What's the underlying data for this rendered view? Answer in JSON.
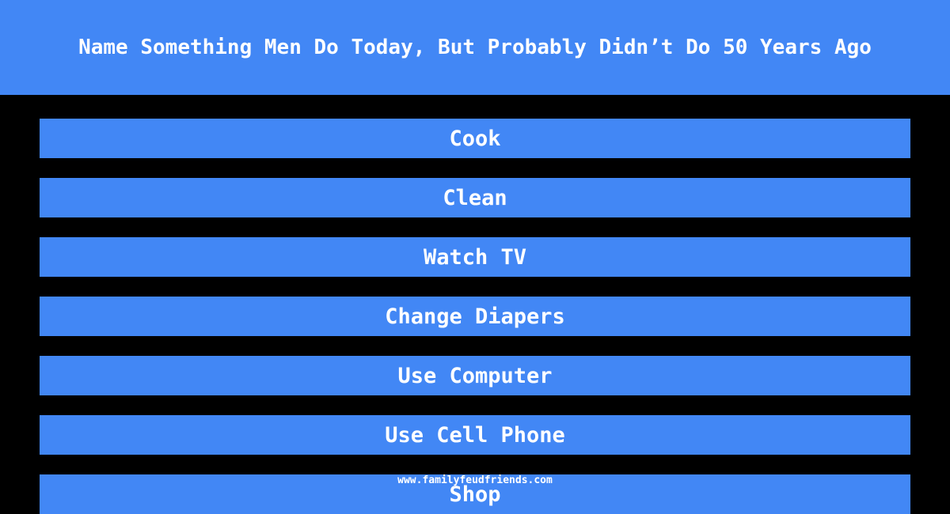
{
  "question": "Name Something Men Do Today, But Probably Didn’t Do 50 Years Ago",
  "answers": [
    {
      "label": "Cook"
    },
    {
      "label": "Clean"
    },
    {
      "label": "Watch TV"
    },
    {
      "label": "Change Diapers"
    },
    {
      "label": "Use Computer"
    },
    {
      "label": "Use Cell Phone"
    },
    {
      "label": "Shop"
    }
  ],
  "watermark": "www.familyfeudfriends.com",
  "colors": {
    "accent": "#4287f5",
    "background": "#000000",
    "text": "#ffffff"
  }
}
